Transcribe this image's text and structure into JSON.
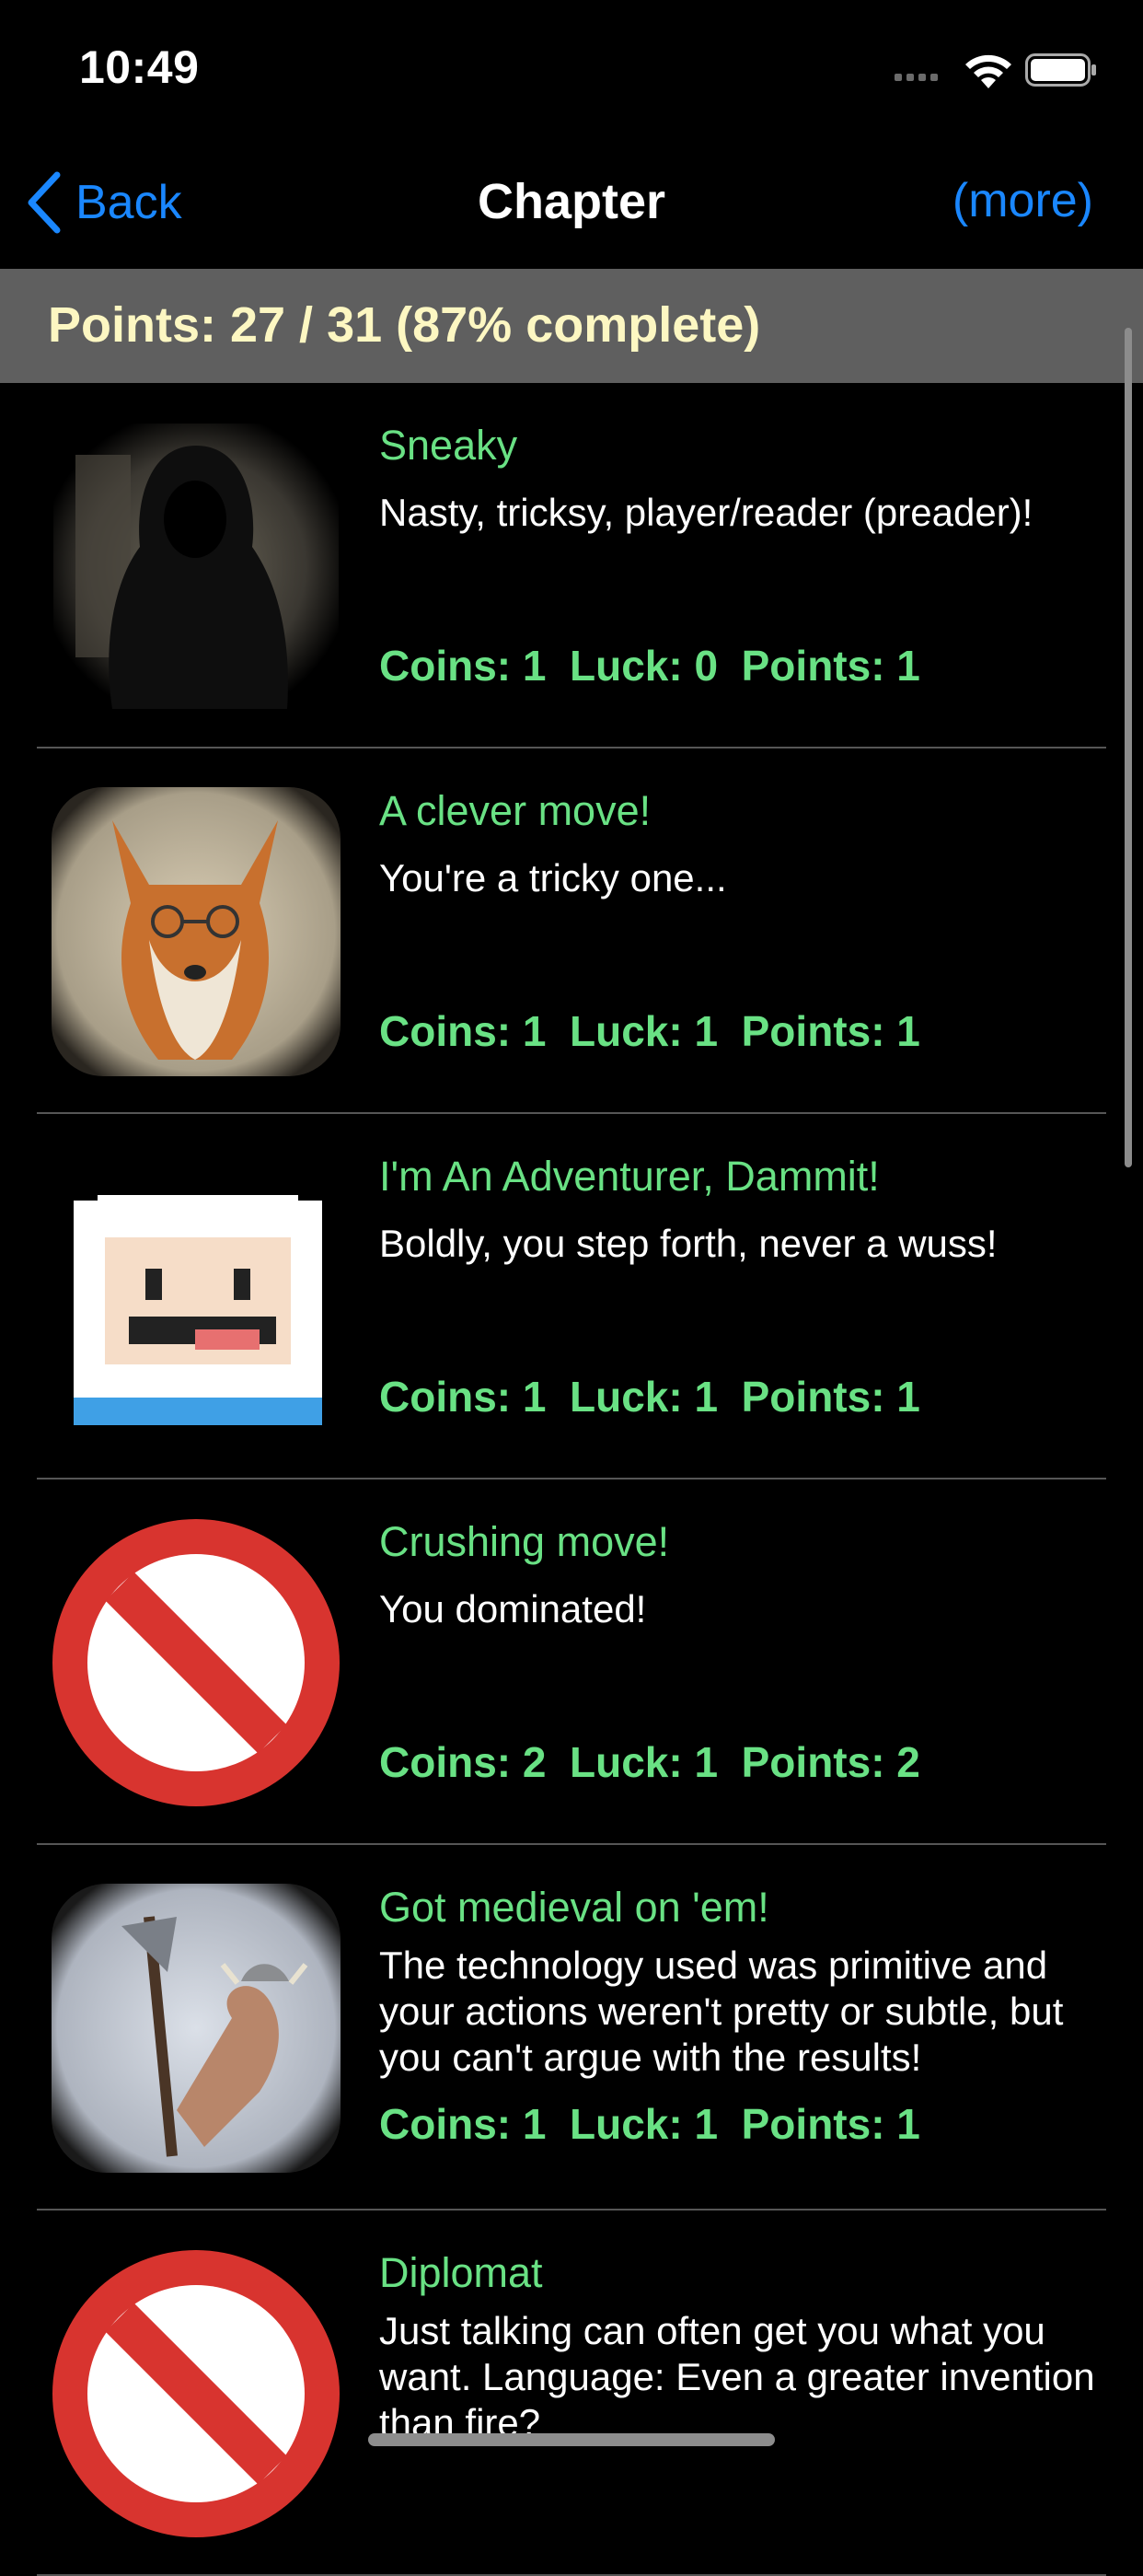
{
  "status_bar": {
    "time": "10:49"
  },
  "nav": {
    "back_label": "Back",
    "title": "Chapter",
    "more_label": "(more)"
  },
  "banner": {
    "text": "Points: 27 / 31 (87% complete)"
  },
  "achievements": [
    {
      "title": "Sneaky",
      "description": "Nasty, tricksy, player/reader (preader)!",
      "stats": "Coins: 1  Luck: 0  Points: 1",
      "image": "hooded-figure"
    },
    {
      "title": "A clever move!",
      "description": "You're a tricky one...",
      "stats": "Coins: 1  Luck: 1  Points: 1",
      "image": "fox-with-glasses"
    },
    {
      "title": "I'm An Adventurer, Dammit!",
      "description": "Boldly, you step forth, never a wuss!",
      "stats": "Coins: 1  Luck: 1  Points: 1",
      "image": "pixel-adventurer"
    },
    {
      "title": "Crushing move!",
      "description": "You dominated!",
      "stats": "Coins: 2  Luck: 1  Points: 2",
      "image": "prohibited-sign"
    },
    {
      "title": "Got medieval on 'em!",
      "description": "The technology used was primitive and your actions weren't pretty or subtle, but you can't argue with the results!",
      "stats": "Coins: 1  Luck: 1  Points: 1",
      "image": "viking-warrior"
    },
    {
      "title": "Diplomat",
      "description": "Just talking can often get you what you want. Language: Even a greater invention than fire?",
      "stats": "",
      "image": "prohibited-sign"
    }
  ],
  "colors": {
    "accent": "#1a87ff",
    "achievement_green": "#69e184",
    "banner_text": "#fdf7c2",
    "banner_bg": "#5f5f5f"
  }
}
